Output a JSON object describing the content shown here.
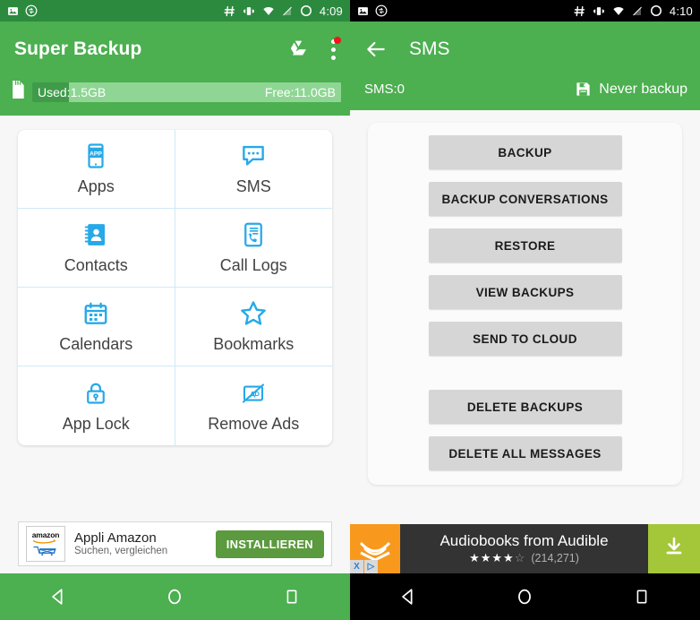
{
  "left": {
    "status_bar": {
      "background": "#2c8a3f",
      "time": "4:09",
      "icons": [
        "image-icon",
        "sync-icon",
        "hash-icon",
        "vibrate-icon",
        "wifi-icon",
        "signal-off-icon",
        "circle-icon"
      ]
    },
    "app_bar": {
      "title": "Super Backup",
      "drive_icon": "google-drive-icon",
      "overflow_icon": "overflow-menu-icon",
      "overflow_badge": true,
      "background": "#4caf50"
    },
    "storage": {
      "sd_icon": "sd-card-icon",
      "used_label": "Used:1.5GB",
      "free_label": "Free:11.0GB",
      "used_percent": 12,
      "used_color": "#3f9b4a",
      "track_color": "#8fd694"
    },
    "tiles": [
      {
        "label": "Apps",
        "icon": "apps-icon"
      },
      {
        "label": "SMS",
        "icon": "sms-bubble-icon"
      },
      {
        "label": "Contacts",
        "icon": "contacts-book-icon"
      },
      {
        "label": "Call Logs",
        "icon": "call-logs-icon"
      },
      {
        "label": "Calendars",
        "icon": "calendar-icon"
      },
      {
        "label": "Bookmarks",
        "icon": "star-outline-icon"
      },
      {
        "label": "App Lock",
        "icon": "padlock-icon"
      },
      {
        "label": "Remove Ads",
        "icon": "no-ads-icon"
      }
    ],
    "ad": {
      "logo_text": "amazon",
      "logo_icon": "amazon-cart-icon",
      "title": "Appli Amazon",
      "subtitle": "Suchen, vergleichen",
      "cta": "INSTALLIEREN",
      "cta_color": "#5b9a3e"
    },
    "nav": {
      "background": "#4caf50",
      "back_icon": "back-triangle-icon",
      "home_icon": "home-circle-icon",
      "recents_icon": "recents-square-icon"
    }
  },
  "right": {
    "status_bar": {
      "background": "#000000",
      "time": "4:10",
      "icons": [
        "image-icon",
        "sync-icon",
        "hash-icon",
        "vibrate-icon",
        "wifi-icon",
        "signal-off-icon",
        "circle-icon"
      ]
    },
    "app_bar": {
      "back_icon": "back-arrow-icon",
      "title": "SMS",
      "background": "#4caf50"
    },
    "sub_bar": {
      "count_label": "SMS:0",
      "save_icon": "floppy-save-icon",
      "backup_status": "Never backup"
    },
    "buttons": [
      {
        "label": "BACKUP",
        "spaced": false
      },
      {
        "label": "BACKUP CONVERSATIONS",
        "spaced": false
      },
      {
        "label": "RESTORE",
        "spaced": false
      },
      {
        "label": "VIEW BACKUPS",
        "spaced": false
      },
      {
        "label": "SEND TO CLOUD",
        "spaced": false
      },
      {
        "label": "DELETE BACKUPS",
        "spaced": true
      },
      {
        "label": "DELETE ALL MESSAGES",
        "spaced": false
      }
    ],
    "ad": {
      "logo_icon": "audible-logo-icon",
      "close_label": "X",
      "adchoices_label": "▷",
      "title": "Audiobooks from Audible",
      "stars_filled": 4,
      "stars_total": 5,
      "rating_count": "(214,271)",
      "download_icon": "download-icon",
      "download_color": "#a4c639"
    },
    "nav": {
      "background": "#000000",
      "back_icon": "back-triangle-icon",
      "home_icon": "home-circle-icon",
      "recents_icon": "recents-square-icon"
    }
  }
}
